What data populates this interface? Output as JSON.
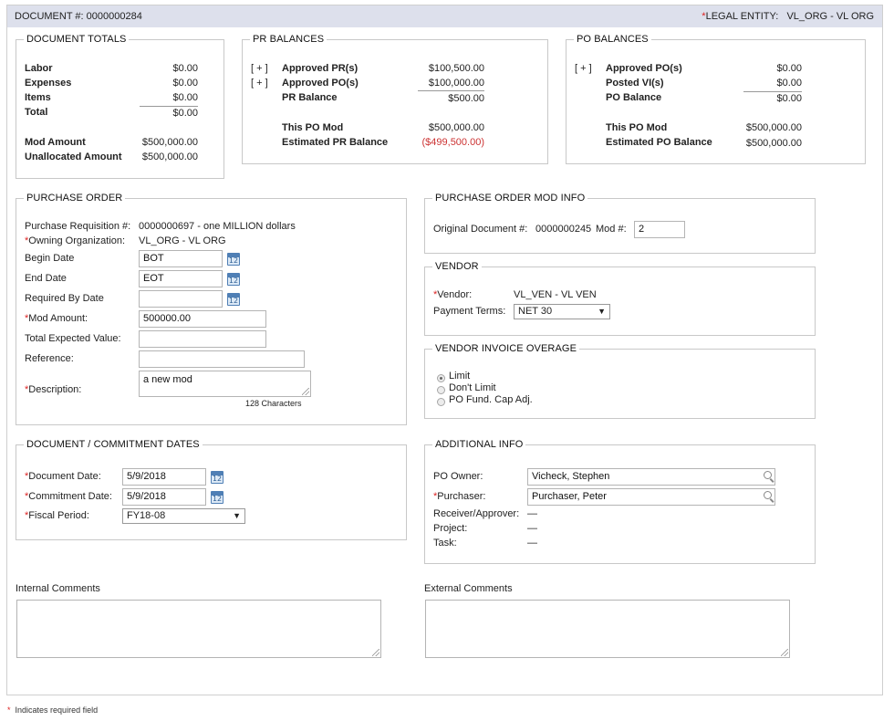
{
  "header": {
    "doc_label": "DOCUMENT #:",
    "doc_number": "0000000284",
    "required_mark": "*",
    "entity_label": "LEGAL ENTITY:",
    "entity_value": "VL_ORG - VL ORG"
  },
  "document_totals": {
    "title": "DOCUMENT TOTALS",
    "rows": [
      {
        "label": "Labor",
        "value": "$0.00"
      },
      {
        "label": "Expenses",
        "value": "$0.00"
      },
      {
        "label": "Items",
        "value": "$0.00"
      },
      {
        "label": "Total",
        "value": "$0.00"
      }
    ],
    "mod_amount_label": "Mod Amount",
    "mod_amount_value": "$500,000.00",
    "unallocated_label": "Unallocated Amount",
    "unallocated_value": "$500,000.00"
  },
  "pr_balances": {
    "title": "PR BALANCES",
    "expand": "[ + ]",
    "approved_pr_label": "Approved PR(s)",
    "approved_pr_value": "$100,500.00",
    "approved_po_label": "Approved PO(s)",
    "approved_po_value": "$100,000.00",
    "pr_balance_label": "PR Balance",
    "pr_balance_value": "$500.00",
    "this_po_mod_label": "This PO Mod",
    "this_po_mod_value": "$500,000.00",
    "estimated_label": "Estimated PR Balance",
    "estimated_value": "($499,500.00)"
  },
  "po_balances": {
    "title": "PO BALANCES",
    "expand": "[ + ]",
    "approved_po_label": "Approved PO(s)",
    "approved_po_value": "$0.00",
    "posted_vi_label": "Posted VI(s)",
    "posted_vi_value": "$0.00",
    "po_balance_label": "PO Balance",
    "po_balance_value": "$0.00",
    "this_po_mod_label": "This PO Mod",
    "this_po_mod_value": "$500,000.00",
    "estimated_label": "Estimated PO Balance",
    "estimated_value": "$500,000.00"
  },
  "purchase_order": {
    "title": "PURCHASE ORDER",
    "req_label": "Purchase Requisition #:",
    "req_value": "0000000697 - one MILLION dollars",
    "owning_label": "Owning Organization:",
    "owning_value": "VL_ORG - VL ORG",
    "begin_label": "Begin Date",
    "begin_value": "BOT",
    "end_label": "End Date",
    "end_value": "EOT",
    "required_by_label": "Required By Date",
    "required_by_value": "",
    "mod_amount_label": "Mod Amount:",
    "mod_amount_value": "500000.00",
    "total_expected_label": "Total Expected Value:",
    "total_expected_value": "",
    "reference_label": "Reference:",
    "reference_value": "",
    "description_label": "Description:",
    "description_value": "a new mod",
    "char_count": "128 Characters"
  },
  "mod_info": {
    "title": "PURCHASE ORDER MOD INFO",
    "original_label": "Original Document #:",
    "original_value": "0000000245",
    "mod_label": "Mod #:",
    "mod_value": "2"
  },
  "vendor": {
    "title": "VENDOR",
    "vendor_label": "Vendor:",
    "vendor_value": "VL_VEN - VL VEN",
    "terms_label": "Payment Terms:",
    "terms_value": "NET 30"
  },
  "overage": {
    "title": "VENDOR INVOICE OVERAGE",
    "options": [
      {
        "label": "Limit",
        "selected": true
      },
      {
        "label": "Don't Limit",
        "selected": false
      },
      {
        "label": "PO Fund. Cap Adj.",
        "selected": false
      }
    ]
  },
  "dates": {
    "title": "DOCUMENT / COMMITMENT DATES",
    "doc_date_label": "Document Date:",
    "doc_date_value": "5/9/2018",
    "commit_label": "Commitment Date:",
    "commit_value": "5/9/2018",
    "fiscal_label": "Fiscal Period:",
    "fiscal_value": "FY18-08"
  },
  "additional": {
    "title": "ADDITIONAL INFO",
    "owner_label": "PO Owner:",
    "owner_value": "Vicheck, Stephen",
    "purchaser_label": "Purchaser:",
    "purchaser_value": "Purchaser, Peter",
    "receiver_label": "Receiver/Approver:",
    "receiver_value": "—",
    "project_label": "Project:",
    "project_value": "—",
    "task_label": "Task:",
    "task_value": "—"
  },
  "comments": {
    "internal_label": "Internal Comments",
    "external_label": "External Comments"
  },
  "footer": {
    "mark": "*",
    "text": "Indicates required field"
  }
}
